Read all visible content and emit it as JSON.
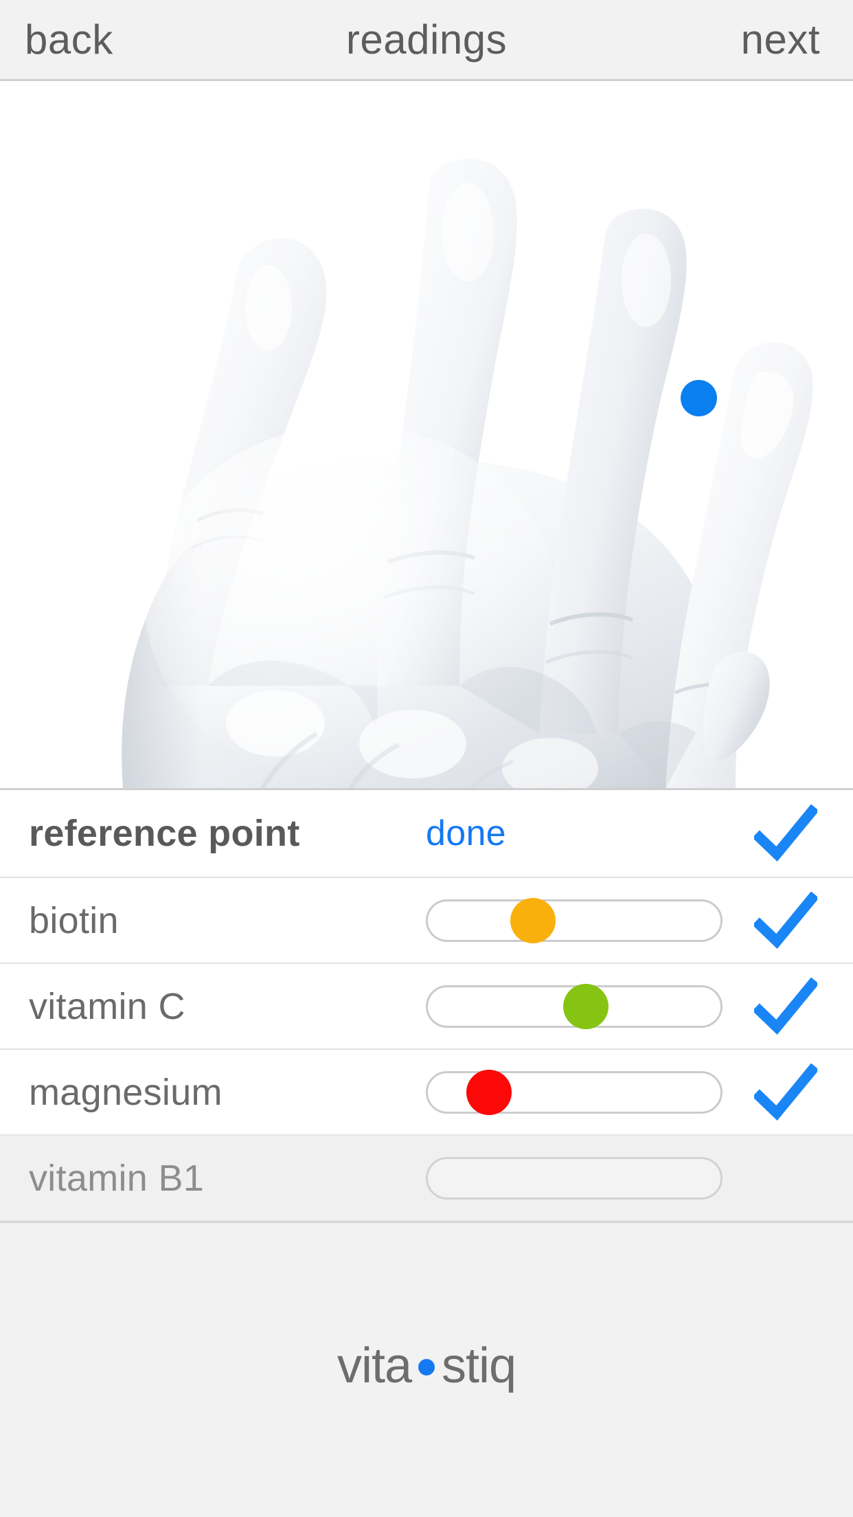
{
  "navbar": {
    "back_label": "back",
    "title": "readings",
    "next_label": "next"
  },
  "hand": {
    "marker_color": "#0a7ff0",
    "marker_label": "measurement-point-pinky"
  },
  "colors": {
    "accent_blue": "#1579f2",
    "check_blue": "#1a86f5",
    "biotin_orange": "#f9b00d",
    "vitaminc_green": "#86c413",
    "magnesium_red": "#fc0808",
    "row_border": "#e3e3e3",
    "disabled_bg": "#f0f0f0"
  },
  "readings": [
    {
      "name": "reference point",
      "action_label": "done",
      "control": "action",
      "checked": true,
      "disabled": false
    },
    {
      "name": "biotin",
      "control": "slider",
      "value_percent": 36,
      "dot_color": "#f9b00d",
      "checked": true,
      "disabled": false
    },
    {
      "name": "vitamin C",
      "control": "slider",
      "value_percent": 54,
      "dot_color": "#86c413",
      "checked": true,
      "disabled": false
    },
    {
      "name": "magnesium",
      "control": "slider",
      "value_percent": 21,
      "dot_color": "#fc0808",
      "checked": true,
      "disabled": false
    },
    {
      "name": "vitamin B1",
      "control": "slider",
      "value_percent": null,
      "dot_color": null,
      "checked": false,
      "disabled": true
    }
  ],
  "footer": {
    "brand_first": "vita",
    "brand_second": "stiq",
    "brand_dot_color": "#1579f2"
  }
}
